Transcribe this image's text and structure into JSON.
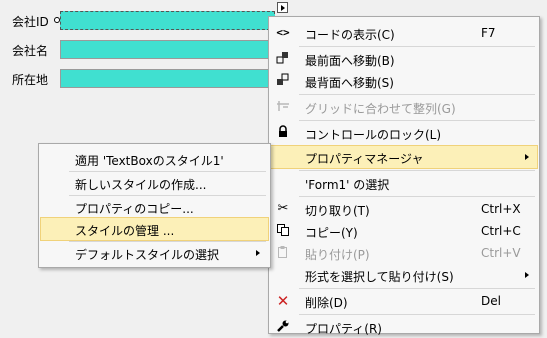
{
  "form": {
    "fields": [
      {
        "label": "会社ID"
      },
      {
        "label": "会社名"
      },
      {
        "label": "所在地"
      }
    ]
  },
  "context_menu": {
    "items": [
      {
        "icon": "code-icon",
        "label": "コードの表示(C)",
        "shortcut": "F7"
      },
      {
        "icon": "bring-to-front-icon",
        "label": "最前面へ移動(B)"
      },
      {
        "icon": "send-to-back-icon",
        "label": "最背面へ移動(S)"
      },
      {
        "icon": "align-to-grid-icon",
        "label": "グリッドに合わせて整列(G)",
        "disabled": true
      },
      {
        "icon": "lock-icon",
        "label": "コントロールのロック(L)"
      },
      {
        "label": "プロパティマネージャ",
        "highlighted": true,
        "submenu": true
      },
      {
        "label": "'Form1' の選択"
      },
      {
        "icon": "cut-icon",
        "label": "切り取り(T)",
        "shortcut": "Ctrl+X"
      },
      {
        "icon": "copy-icon",
        "label": "コピー(Y)",
        "shortcut": "Ctrl+C"
      },
      {
        "icon": "paste-icon",
        "label": "貼り付け(P)",
        "shortcut": "Ctrl+V",
        "disabled": true
      },
      {
        "label": "形式を選択して貼り付け(S)",
        "submenu": true
      },
      {
        "icon": "delete-icon",
        "label": "削除(D)",
        "shortcut": "Del"
      },
      {
        "icon": "wrench-icon",
        "label": "プロパティ(R)"
      }
    ]
  },
  "submenu": {
    "items": [
      {
        "label": "適用 'TextBoxのスタイル1'"
      },
      {
        "label": "新しいスタイルの作成..."
      },
      {
        "label": "プロパティのコピー..."
      },
      {
        "label": "スタイルの管理 ...",
        "highlighted": true
      },
      {
        "label": "デフォルトスタイルの選択",
        "submenu": true
      }
    ]
  },
  "colors": {
    "textbox_fill": "#40e0d0",
    "highlight": "#fcf0b8",
    "delete_icon": "#cc2222"
  }
}
